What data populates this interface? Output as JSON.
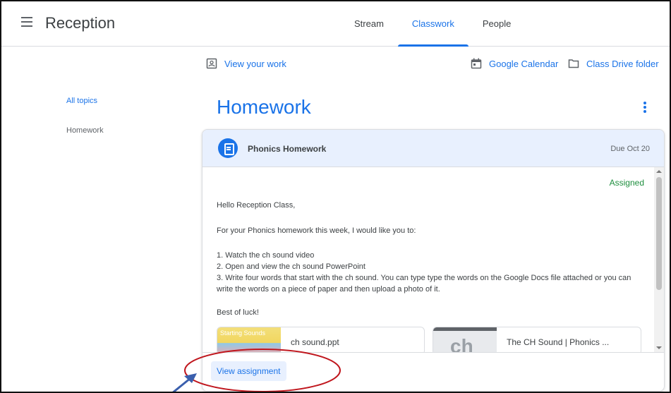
{
  "header": {
    "app_title": "Reception",
    "tabs": [
      {
        "label": "Stream",
        "active": false
      },
      {
        "label": "Classwork",
        "active": true
      },
      {
        "label": "People",
        "active": false
      }
    ]
  },
  "links": {
    "view_work": "View your work",
    "calendar": "Google Calendar",
    "drive": "Class Drive folder"
  },
  "topics": {
    "items": [
      "All topics",
      "Homework"
    ],
    "selected": "All topics"
  },
  "section": {
    "title": "Homework"
  },
  "assignment": {
    "title": "Phonics Homework",
    "due": "Due Oct 20",
    "status": "Assigned",
    "body": {
      "greeting": "Hello Reception Class,",
      "intro": "For your Phonics homework this week, I would like you to:",
      "step1": "1. Watch the ch sound video",
      "step2": "2. Open and view the ch sound PowerPoint",
      "step3": "3. Write four words that start with the ch sound. You can type type the words on the Google Docs file attached or you can write the words on a piece of paper and then upload a photo of it.",
      "closing": "Best of luck!"
    },
    "attachments": [
      {
        "label": "ch sound.ppt",
        "thumb_text": "Starting Sounds"
      },
      {
        "label": "The CH Sound | Phonics ...",
        "thumb_text": "ch"
      }
    ],
    "view_button": "View assignment"
  },
  "icons": {
    "menu": "menu-icon",
    "portfolio": "portfolio-icon",
    "calendar": "calendar-icon",
    "folder": "folder-icon",
    "assignment": "assignment-icon",
    "more": "more-vert-icon"
  },
  "colors": {
    "accent": "#1a73e8",
    "assigned_green": "#1e8e3e",
    "card_header_bg": "#e8f0fe",
    "annotation_red": "#c0161d",
    "annotation_arrow": "#3a5fad"
  }
}
